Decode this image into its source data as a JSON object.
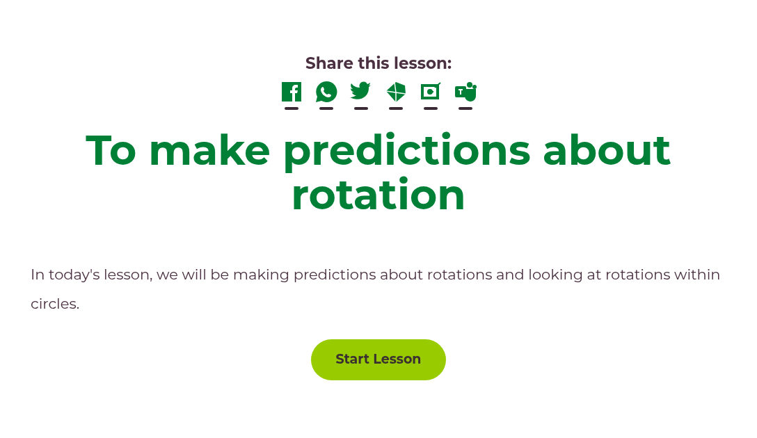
{
  "share": {
    "label": "Share this lesson:",
    "buttons": [
      {
        "kind": "facebook"
      },
      {
        "kind": "whatsapp"
      },
      {
        "kind": "twitter"
      },
      {
        "kind": "email"
      },
      {
        "kind": "classroom"
      },
      {
        "kind": "teams"
      }
    ]
  },
  "title": "To make predictions about rotation",
  "description": "In today's lesson, we will be making predictions about rotations and looking at rotations within circles.",
  "start_button": "Start Lesson"
}
